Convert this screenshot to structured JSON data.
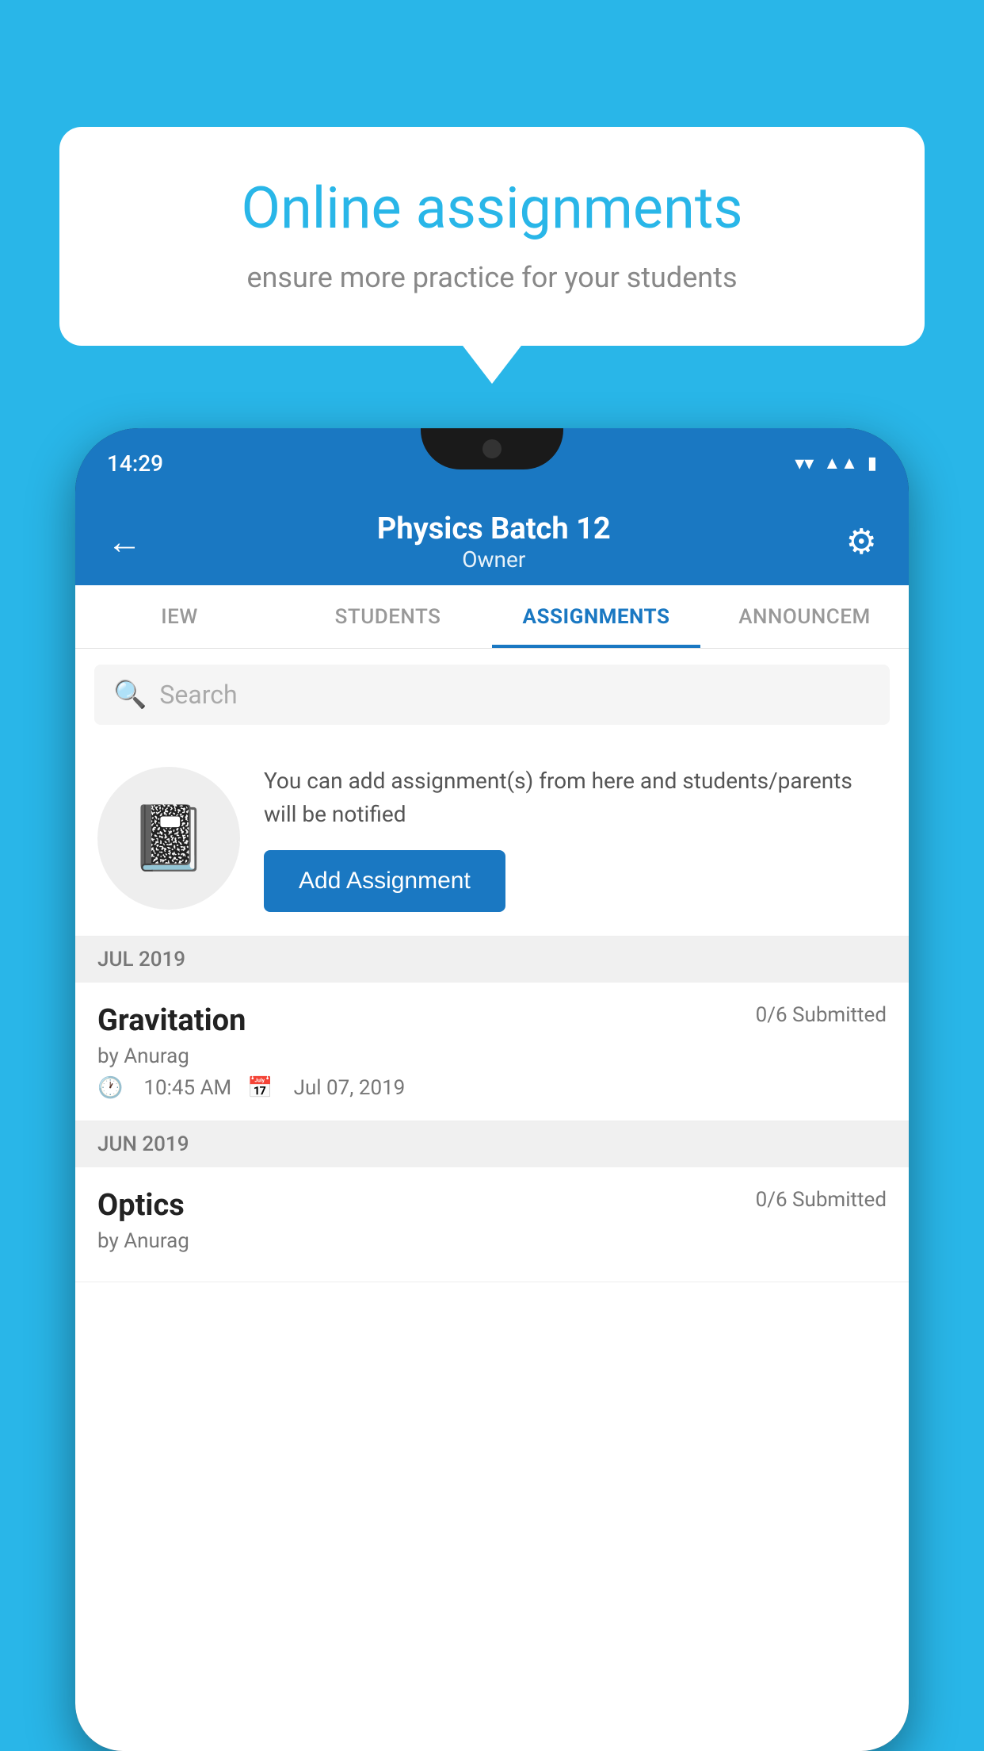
{
  "background_color": "#29b6e8",
  "speech_bubble": {
    "title": "Online assignments",
    "subtitle": "ensure more practice for your students"
  },
  "status_bar": {
    "time": "14:29",
    "wifi_icon": "wifi",
    "signal_icon": "signal",
    "battery_icon": "battery"
  },
  "app_header": {
    "title": "Physics Batch 12",
    "subtitle": "Owner",
    "back_icon": "←",
    "settings_icon": "⚙"
  },
  "tabs": [
    {
      "label": "IEW",
      "active": false
    },
    {
      "label": "STUDENTS",
      "active": false
    },
    {
      "label": "ASSIGNMENTS",
      "active": true
    },
    {
      "label": "ANNOUNCEM",
      "active": false
    }
  ],
  "search": {
    "placeholder": "Search",
    "icon": "🔍"
  },
  "promo": {
    "icon": "📒",
    "text": "You can add assignment(s) from here and students/parents will be notified",
    "button_label": "Add Assignment"
  },
  "sections": [
    {
      "month": "JUL 2019",
      "assignments": [
        {
          "name": "Gravitation",
          "submitted": "0/6 Submitted",
          "by": "by Anurag",
          "time": "10:45 AM",
          "date": "Jul 07, 2019"
        }
      ]
    },
    {
      "month": "JUN 2019",
      "assignments": [
        {
          "name": "Optics",
          "submitted": "0/6 Submitted",
          "by": "by Anurag",
          "time": "",
          "date": ""
        }
      ]
    }
  ]
}
